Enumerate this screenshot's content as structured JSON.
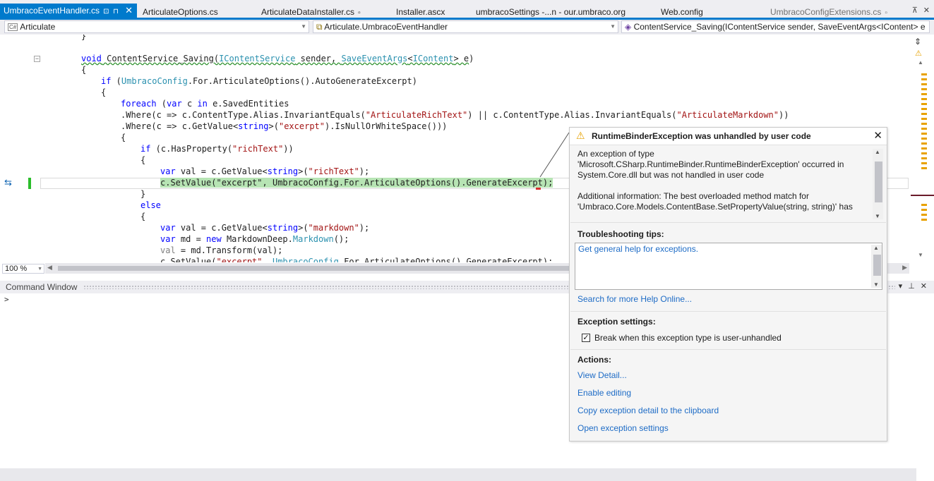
{
  "tabs": [
    {
      "label": "UmbracoEventHandler.cs",
      "active": true
    },
    {
      "label": "ArticulateOptions.cs"
    },
    {
      "label": "ArticulateDataInstaller.cs"
    },
    {
      "label": "Installer.ascx"
    },
    {
      "label": "umbracoSettings -...n - our.umbraco.org"
    },
    {
      "label": "Web.config"
    },
    {
      "label": "UmbracoConfigExtensions.cs"
    }
  ],
  "navbar": {
    "project": "Articulate",
    "type": "Articulate.UmbracoEventHandler",
    "member": "ContentService_Saving(IContentService sender, SaveEventArgs<IContent> e"
  },
  "zoom": "100 %",
  "command_window": {
    "title": "Command Window",
    "prompt": ">"
  },
  "exception": {
    "title": "RuntimeBinderException was unhandled by user code",
    "message_1": "An exception of type 'Microsoft.CSharp.RuntimeBinder.RuntimeBinderException' occurred in System.Core.dll but was not handled in user code",
    "message_2": "Additional information: The best overloaded method match for 'Umbraco.Core.Models.ContentBase.SetPropertyValue(string, string)' has",
    "troubleshooting_heading": "Troubleshooting tips:",
    "tip_link": "Get general help for exceptions.",
    "search_link": "Search for more Help Online...",
    "settings_heading": "Exception settings:",
    "break_label": "Break when this exception type is user-unhandled",
    "break_checked": true,
    "actions_heading": "Actions:",
    "actions": [
      "View Detail...",
      "Enable editing",
      "Copy exception detail to the clipboard",
      "Open exception settings"
    ]
  }
}
